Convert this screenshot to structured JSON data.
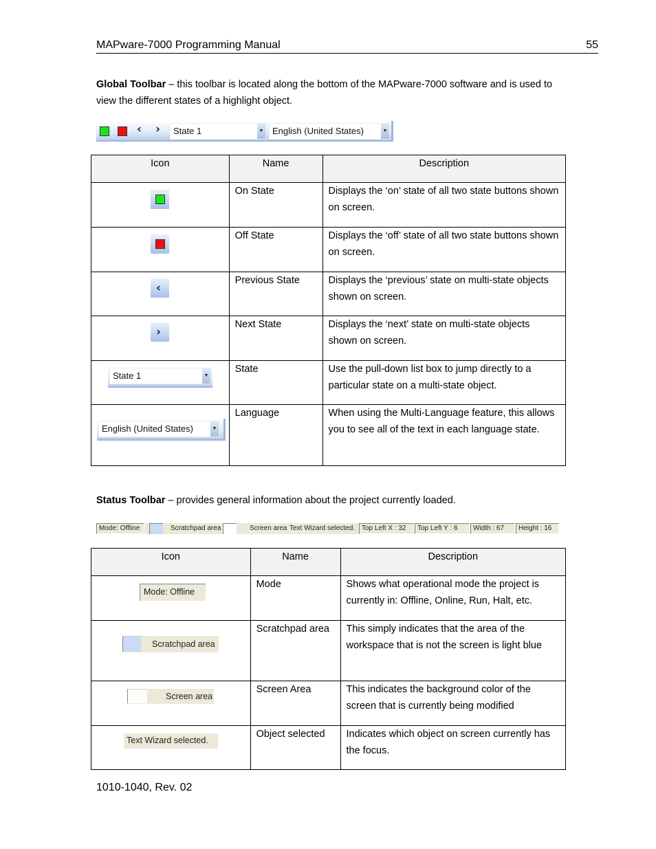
{
  "header": {
    "title": "MAPware-7000 Programming Manual",
    "page_number": "55"
  },
  "global_toolbar_section": {
    "heading": "Global Toolbar",
    "text": " – this toolbar is located along the bottom of the MAPware-7000 software and is used to view the different states of a highlight object.",
    "toolbar": {
      "on_icon": "green-square-icon",
      "off_icon": "red-square-icon",
      "prev_icon": "chevron-left-icon",
      "next_icon": "chevron-right-icon",
      "prev_glyph": "‹",
      "next_glyph": "›",
      "state_value": "State 1",
      "language_value": "English (United States)",
      "dropdown_glyph": "▼"
    },
    "table": {
      "columns": [
        "Icon",
        "Name",
        "Description"
      ],
      "rows": [
        {
          "icon": "on-state-icon",
          "name": "On State",
          "description": "Displays the ‘on’ state of all two state buttons shown on screen."
        },
        {
          "icon": "off-state-icon",
          "name": "Off State",
          "description": "Displays the ‘off’ state of all two state buttons shown on screen."
        },
        {
          "icon": "previous-state-icon",
          "name": "Previous State",
          "description": "Displays the ‘previous’ state on multi-state objects shown on screen."
        },
        {
          "icon": "next-state-icon",
          "name": "Next State",
          "description": "Displays the ‘next’ state on multi-state objects shown on screen."
        },
        {
          "icon": "state-dropdown",
          "icon_text": "State 1",
          "name": "State",
          "description": "Use the pull-down list box to jump directly to a particular state on a multi-state object."
        },
        {
          "icon": "language-dropdown",
          "icon_text": "English (United States)",
          "name": "Language",
          "description": "When using the Multi-Language feature, this allows you to see all of the text in each language state."
        }
      ]
    }
  },
  "status_toolbar_section": {
    "heading": "Status Toolbar",
    "text": " – provides general information about the project currently loaded.",
    "toolbar": {
      "mode": "Mode: Offline",
      "scratchpad_label": "Scratchpad area",
      "scratchpad_color": "#c9dbf5",
      "screen_label": "Screen area",
      "screen_color": "#ffffff",
      "selected": "Text Wizard selected.",
      "top_left_x": "Top Left X : 32",
      "top_left_y": "Top Left Y : 6",
      "width": "Width : 67",
      "height": "Height : 16"
    },
    "table": {
      "columns": [
        "Icon",
        "Name",
        "Description"
      ],
      "rows": [
        {
          "icon_text": "Mode: Offline",
          "name": "Mode",
          "description": "Shows what operational mode the project is currently in: Offline, Online, Run, Halt, etc."
        },
        {
          "icon_text": "Scratchpad area",
          "name": "Scratchpad area",
          "description": "This simply indicates that the area of the workspace that is not the screen is light blue"
        },
        {
          "icon_text": "Screen area",
          "name": "Screen Area",
          "description": "This indicates the background color of the screen that is currently being modified"
        },
        {
          "icon_text": "Text Wizard selected.",
          "name": "Object selected",
          "description": "Indicates which object on screen currently has the focus."
        }
      ]
    }
  },
  "footer": {
    "doc_number": "1010-1040, Rev. 02"
  }
}
